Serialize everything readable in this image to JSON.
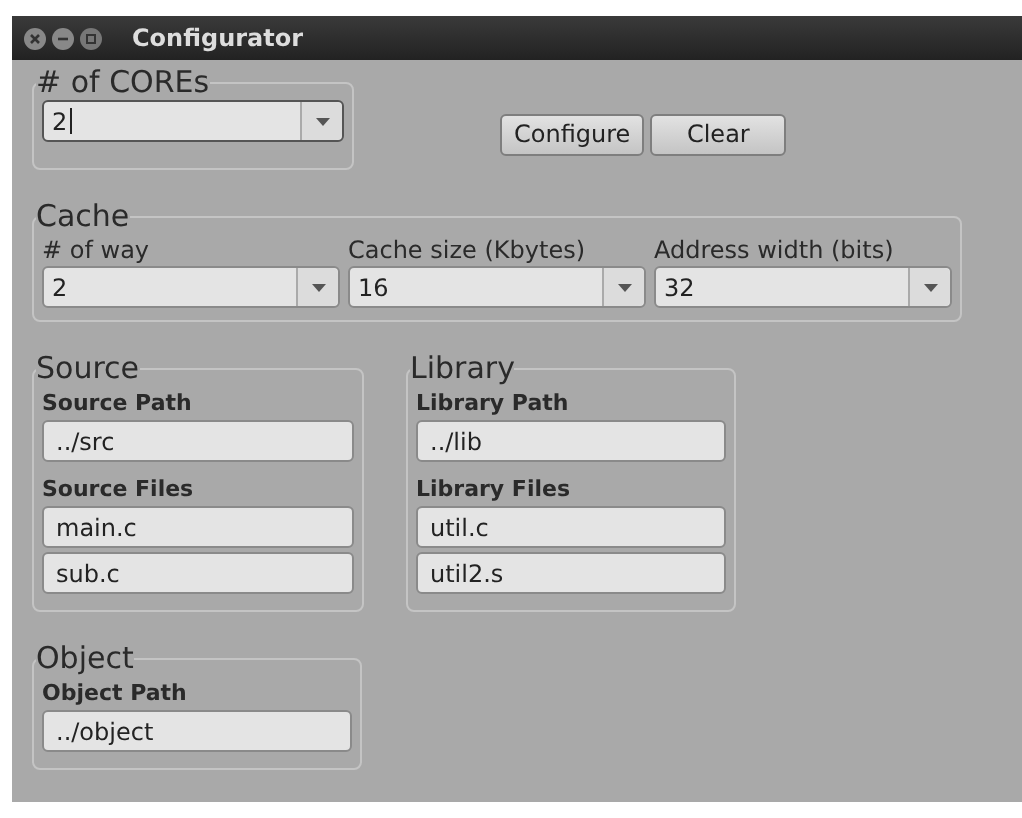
{
  "window": {
    "title": "Configurator"
  },
  "cores": {
    "title": "# of COREs",
    "value": "2",
    "focused": true
  },
  "buttons": [
    "Configure",
    "Clear"
  ],
  "cache": {
    "title": "Cache",
    "fields": [
      {
        "label": "# of way",
        "value": "2"
      },
      {
        "label": "Cache size (Kbytes)",
        "value": "16"
      },
      {
        "label": "Address width (bits)",
        "value": "32"
      }
    ]
  },
  "source": {
    "title": "Source",
    "path_label": "Source Path",
    "path": "../src",
    "files_label": "Source Files",
    "files": [
      "main.c",
      "sub.c"
    ]
  },
  "library": {
    "title": "Library",
    "path_label": "Library Path",
    "path": "../lib",
    "files_label": "Library Files",
    "files": [
      "util.c",
      "util2.s"
    ]
  },
  "object": {
    "title": "Object",
    "path_label": "Object Path",
    "path": "../object"
  }
}
